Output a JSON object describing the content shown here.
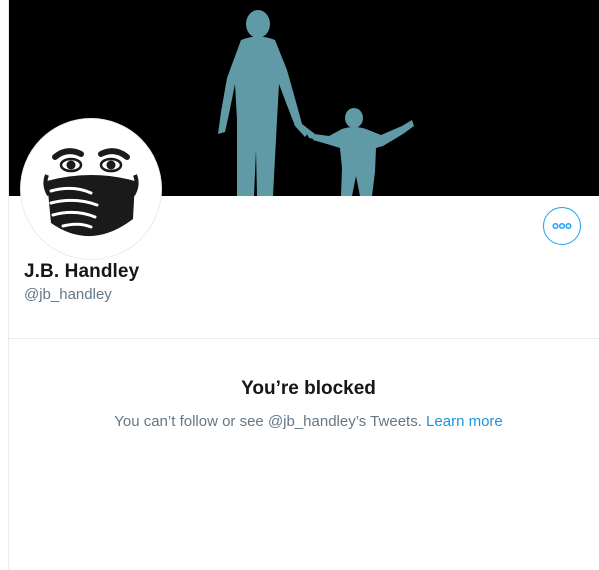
{
  "profile": {
    "display_name": "J.B. Handley",
    "handle": "@jb_handley"
  },
  "actions": {
    "more_icon": "more-horizontal-icon"
  },
  "blocked": {
    "title": "You’re blocked",
    "message": "You can’t follow or see @jb_handley’s Tweets.",
    "learn_more": "Learn more"
  },
  "colors": {
    "accent": "#1da1f2",
    "link": "#1b95e0",
    "banner_background": "#000000",
    "banner_figures": "#5f9aa6",
    "text_primary": "#14171a",
    "text_secondary": "#657786"
  }
}
